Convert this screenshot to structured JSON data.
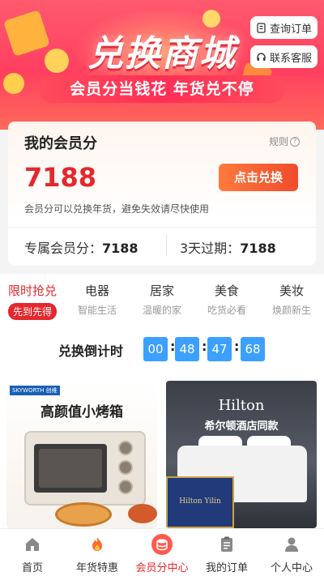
{
  "banner": {
    "title": "兑换商城",
    "subtitle": "会员分当钱花 年货兑不停",
    "query_orders": "查询订单",
    "contact_service": "联系客服"
  },
  "points_card": {
    "title": "我的会员分",
    "rules": "规则",
    "points": "7188",
    "redeem_button": "点击兑换",
    "note": "会员分可以兑换年货，避免失效请尽快使用",
    "exclusive_label": "专属会员分：",
    "exclusive_value": "7188",
    "expire_label": "3天过期：",
    "expire_value": "7188"
  },
  "tabs": [
    {
      "label": "限时抢兑",
      "sub": "先到先得",
      "active": true
    },
    {
      "label": "电器",
      "sub": "智能生活",
      "active": false
    },
    {
      "label": "居家",
      "sub": "温暖的家",
      "active": false
    },
    {
      "label": "美食",
      "sub": "吃货必看",
      "active": false
    },
    {
      "label": "美妆",
      "sub": "焕颜新生",
      "active": false
    }
  ],
  "countdown": {
    "label": "兑换倒计时",
    "values": [
      "00",
      "48",
      "47",
      "68"
    ]
  },
  "products": [
    {
      "brand": "SKYWORTH 创维",
      "title": "高颜值小烤箱"
    },
    {
      "brand": "Hilton",
      "title": "希尔顿酒店同款",
      "bag_text": "Hilton Yilin"
    }
  ],
  "nav": [
    {
      "label": "首页",
      "icon": "home-icon",
      "active": false
    },
    {
      "label": "年货特惠",
      "icon": "fire-icon",
      "active": false
    },
    {
      "label": "会员分中心",
      "icon": "coins-icon",
      "active": true
    },
    {
      "label": "我的订单",
      "icon": "clipboard-icon",
      "active": false
    },
    {
      "label": "个人中心",
      "icon": "user-icon",
      "active": false
    }
  ],
  "colors": {
    "accent_red": "#e4282e",
    "countdown_blue": "#3ba0ff",
    "banner_pink": "#ff3f60"
  }
}
